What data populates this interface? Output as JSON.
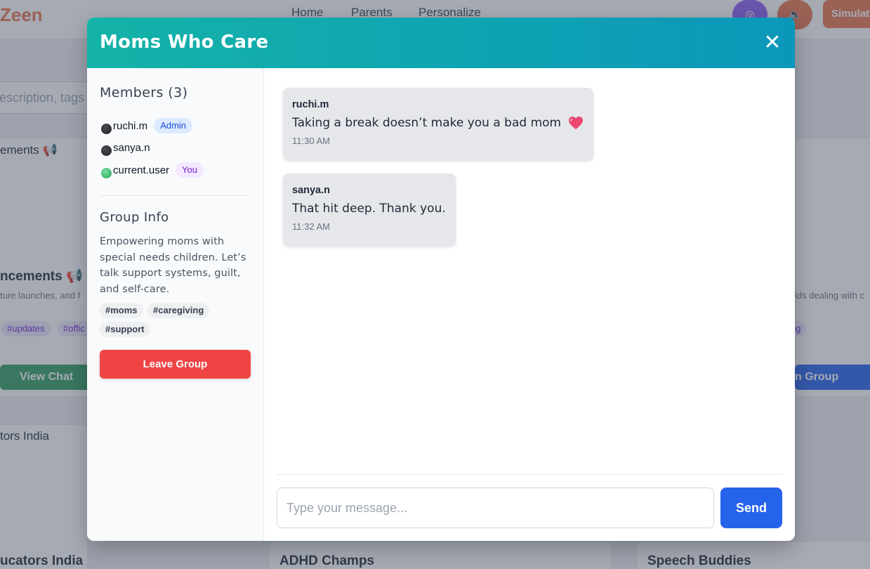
{
  "background": {
    "logo": "Zeen",
    "nav": [
      "Home",
      "Parents",
      "Personalize"
    ],
    "simulate_label": "Simulat",
    "search_placeholder": "escription, tags",
    "cards": {
      "announcements_small": "ements 📢",
      "announcements_title": "ncements 📢",
      "announcements_desc": "ture launches, and f",
      "right_desc": "ids dealing with c",
      "tags": [
        "#updates",
        "#offic"
      ],
      "right_tag": "ng",
      "view_chat": "View Chat",
      "join_group": "n Group",
      "educators_small": "tors India",
      "bottom_titles": [
        "ucators India",
        "ADHD Champs",
        "Speech Buddies"
      ]
    }
  },
  "modal": {
    "title": "Moms Who Care",
    "close_symbol": "✕",
    "members_heading": "Members (3)",
    "members": [
      {
        "name": "ruchi.m",
        "badge": "Admin",
        "status": "offline"
      },
      {
        "name": "sanya.n",
        "badge": "",
        "status": "offline"
      },
      {
        "name": "current.user",
        "badge": "You",
        "status": "online"
      }
    ],
    "group_info_heading": "Group Info",
    "description": "Empowering moms with special needs children. Let’s talk support systems, guilt, and self-care.",
    "tags": [
      "#moms",
      "#caregiving",
      "#support"
    ],
    "leave_label": "Leave Group"
  },
  "chat": {
    "messages": [
      {
        "user": "ruchi.m",
        "text": "Taking a break doesn’t make you a bad mom",
        "emoji": "heart-icon",
        "time": "11:30 AM"
      },
      {
        "user": "sanya.n",
        "text": "That hit deep. Thank you.",
        "emoji": "",
        "time": "11:32 AM"
      }
    ],
    "input_placeholder": "Type your message...",
    "input_value": "",
    "send_label": "Send"
  },
  "colors": {
    "header_gradient_start": "#14b3a8",
    "header_gradient_end": "#0b97ba",
    "leave_button": "#ef4444",
    "send_button": "#2563eb",
    "admin_badge_bg": "#dbeafe",
    "you_badge_bg": "#f3e8ff",
    "online_dot": "#22a35b"
  }
}
